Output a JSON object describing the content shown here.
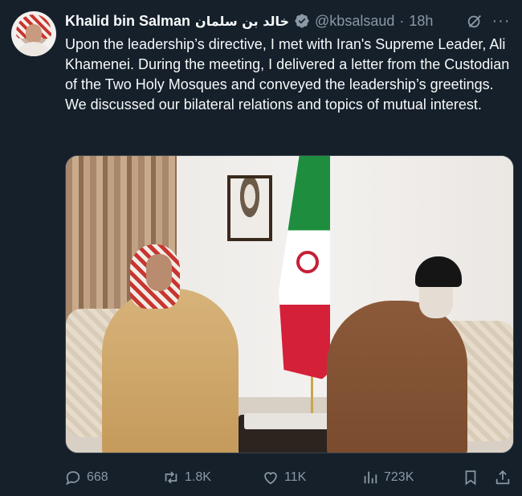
{
  "author": {
    "name": "Khalid bin Salman",
    "name_arabic": "خالد بن سلمان",
    "handle": "@kbsalsaud",
    "separator": "·",
    "time": "18h",
    "verified": true
  },
  "header_icons": {
    "grok": "grok-icon",
    "more": "more-icon",
    "more_glyph": "···"
  },
  "tweet": {
    "text": "Upon the leadership’s directive, I met with Iran's Supreme Leader, Ali Khamenei. During the meeting, I delivered a letter from the Custodian of the Two Holy Mosques and conveyed the leadership’s greetings. We discussed our bilateral relations and topics of mutual interest."
  },
  "actions": {
    "replies": "668",
    "reposts": "1.8K",
    "likes": "11K",
    "views": "723K"
  },
  "colors": {
    "background": "#15202b",
    "text": "#f7f9f9",
    "secondary": "#8b98a5",
    "verified": "#8b98a5",
    "border": "#38444d"
  }
}
